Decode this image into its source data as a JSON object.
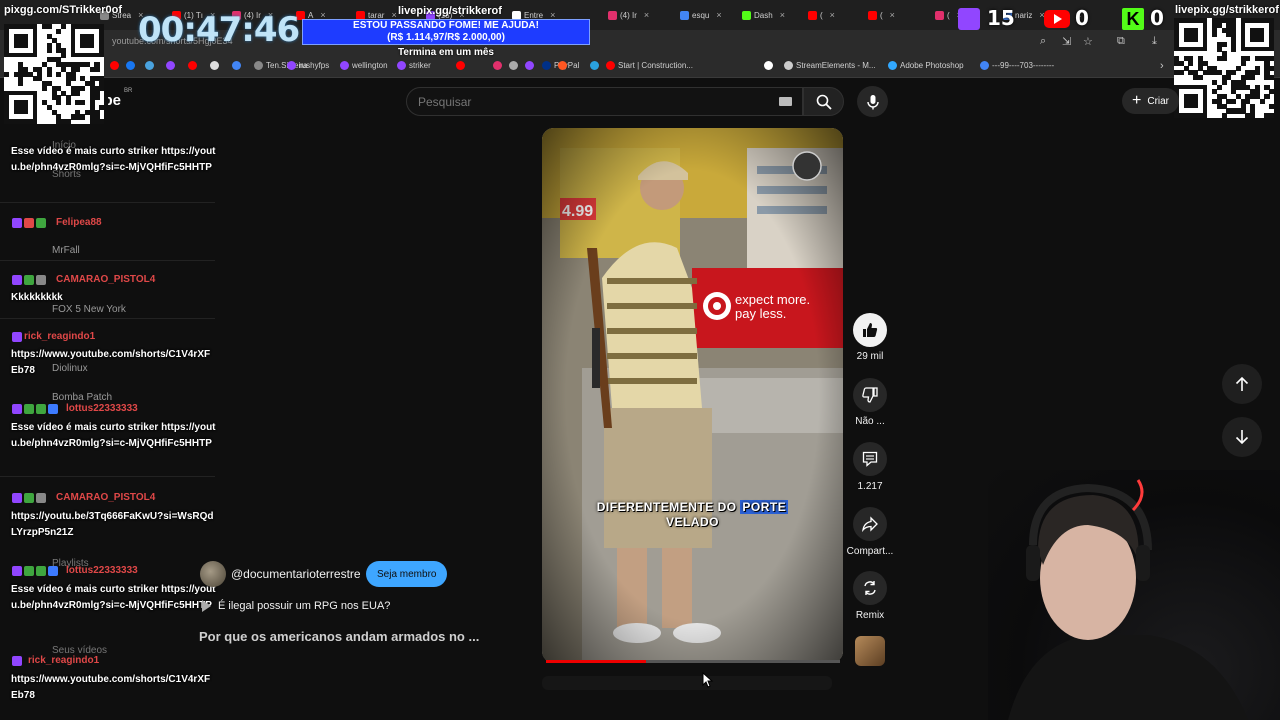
{
  "stream_overlay": {
    "pix_label_left": "pixgg.com/STrikker0of",
    "pix_label_right": "livepix.gg/strikkerof",
    "timer": "00:47:46",
    "goal_url": "livepix.gg/strikkerof",
    "goal_line1": "ESTOU PASSANDO FOME! ME AJUDA!",
    "goal_line2": "(R$ 1.114,97/R$ 2.000,00)",
    "goal_time": "Termina em um mês",
    "counter_twitch": "15",
    "counter_youtube": "0",
    "counter_kick": "0"
  },
  "browser": {
    "tabs": [
      {
        "label": "Strea",
        "color": "#888888"
      },
      {
        "label": "(1) Tı",
        "color": "#ff0000"
      },
      {
        "label": "(4) Ir",
        "color": "#e1306c"
      },
      {
        "label": "A",
        "color": "#ff0000"
      },
      {
        "label": "tarar",
        "color": "#ff0000"
      },
      {
        "label": "(13)",
        "color": "#9146ff"
      },
      {
        "label": "Entre",
        "color": "#ffffff"
      },
      {
        "label": "(4) Ir",
        "color": "#e1306c"
      },
      {
        "label": "esqu",
        "color": "#4285f4"
      },
      {
        "label": "Dash",
        "color": "#53fc18"
      },
      {
        "label": "(",
        "color": "#ff0000"
      },
      {
        "label": "(",
        "color": "#ff0000"
      },
      {
        "label": "(",
        "color": "#e1306c"
      },
      {
        "label": "nariz",
        "color": "#4285f4"
      },
      {
        "label": "(1",
        "color": "#e1306c"
      }
    ],
    "url": "youtube.com/shorts/5Hgj0E34",
    "bookmarks": [
      {
        "label": "",
        "color": "#ff0000"
      },
      {
        "label": "",
        "color": "#1877f2"
      },
      {
        "label": "",
        "color": "#4aa3df"
      },
      {
        "label": "",
        "color": "#9146ff"
      },
      {
        "label": "",
        "color": "#ff0000"
      },
      {
        "label": "",
        "color": "#dddddd"
      },
      {
        "label": "",
        "color": "#4285f4"
      },
      {
        "label": "Ten.Silveira",
        "color": "#888888"
      },
      {
        "label": "rushyfps",
        "color": "#9146ff"
      },
      {
        "label": "wellington",
        "color": "#9146ff"
      },
      {
        "label": "striker",
        "color": "#9146ff"
      },
      {
        "label": "",
        "color": "#ff0000"
      },
      {
        "label": "",
        "color": "#e1306c"
      },
      {
        "label": "",
        "color": "#aaaaaa"
      },
      {
        "label": "",
        "color": "#9146ff"
      },
      {
        "label": "PayPal",
        "color": "#003087"
      },
      {
        "label": "",
        "color": "#ff5722"
      },
      {
        "label": "",
        "color": "#2aa1de"
      },
      {
        "label": "Start | Construction...",
        "color": "#ff0000"
      },
      {
        "label": "",
        "color": "#ffffff"
      },
      {
        "label": "StreamElements - M...",
        "color": "#cccccc"
      },
      {
        "label": "Adobe Photoshop",
        "color": "#31a8ff"
      },
      {
        "label": "---99----703--------",
        "color": "#4285f4"
      }
    ]
  },
  "youtube": {
    "logo": "YouTube",
    "region": "BR",
    "search_placeholder": "Pesquisar",
    "create_label": "Criar"
  },
  "chat": {
    "messages": [
      {
        "user": "",
        "user_color": "#e04848",
        "text": "Esse vídeo é mais curto striker https://youtu.be/phn4vzR0mlg?si=c-MjVQHfiFc5HHTP"
      },
      {
        "user": "Felipea88",
        "user_color": "#e04848",
        "text": ""
      },
      {
        "user": "CAMARAO_PISTOL4",
        "user_color": "#e04848",
        "text": "Kkkkkkkkk"
      },
      {
        "user": "rick_reagindo1",
        "user_color": "#e04848",
        "text": "https://www.youtube.com/shorts/C1V4rXFEb78"
      },
      {
        "user": "lottus22333333",
        "user_color": "#e04848",
        "text": "Esse vídeo é mais curto striker https://youtu.be/phn4vzR0mlg?si=c-MjVQHfiFc5HHTP"
      },
      {
        "user": "CAMARAO_PISTOL4",
        "user_color": "#e04848",
        "text": "https://youtu.be/3Tq666FaKwU?si=WsRQdLYrzpP5n21Z"
      },
      {
        "user": "lottus22333333",
        "user_color": "#e04848",
        "text": "Esse vídeo é mais curto striker https://youtu.be/phn4vzR0mlg?si=c-MjVQHfiFc5HHTP"
      },
      {
        "user": "rick_reagindo1",
        "user_color": "#e04848",
        "text": "https://www.youtube.com/shorts/C1V4rXFEb78"
      }
    ],
    "sidebar_ghost": [
      "Início",
      "Shorts",
      "MrFall",
      "FOX 5 New York",
      "Diolinux",
      "Bomba Patch",
      "Playlists",
      "Seus vídeos"
    ]
  },
  "short": {
    "caption_plain": "DIFERENTEMENTE DO",
    "caption_highlight": "PORTE",
    "caption_line2": "VELADO",
    "video_progress_fraction": 0.34,
    "channel": "@documentarioterrestre",
    "member_button": "Seja membro",
    "sound_text": "É ilegal possuir um RPG nos EUA?",
    "title": "Por que os americanos andam armados no ..."
  },
  "actions": {
    "like_count": "29 mil",
    "dislike_label": "Não ...",
    "comment_count": "1.217",
    "share_label": "Compart...",
    "remix_label": "Remix"
  }
}
